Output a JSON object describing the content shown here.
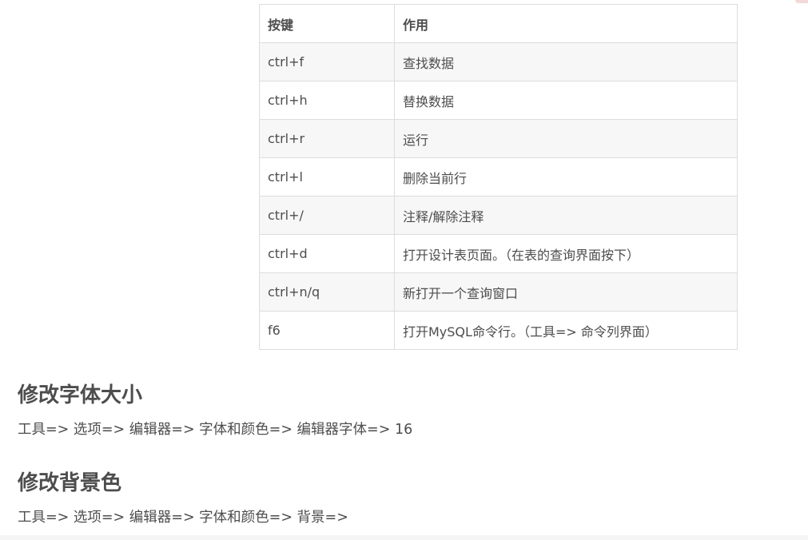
{
  "table": {
    "headers": [
      "按键",
      "作用"
    ],
    "rows": [
      {
        "key": "ctrl+f",
        "action": "查找数据"
      },
      {
        "key": "ctrl+h",
        "action": "替换数据"
      },
      {
        "key": "ctrl+r",
        "action": "运行"
      },
      {
        "key": "ctrl+l",
        "action": "删除当前行"
      },
      {
        "key": "ctrl+/",
        "action": "注释/解除注释"
      },
      {
        "key": "ctrl+d",
        "action": "打开设计表页面。（在表的查询界面按下）"
      },
      {
        "key": "ctrl+n/q",
        "action": "新打开一个查询窗口"
      },
      {
        "key": "f6",
        "action": "打开MySQL命令行。（工具=> 命令列界面）"
      }
    ]
  },
  "sections": {
    "font": {
      "title": "修改字体大小",
      "text": "工具=> 选项=> 编辑器=> 字体和颜色=> 编辑器字体=> 16"
    },
    "background": {
      "title": "修改背景色",
      "text": "工具=> 选项=> 编辑器=> 字体和颜色=> 背景=>"
    }
  }
}
